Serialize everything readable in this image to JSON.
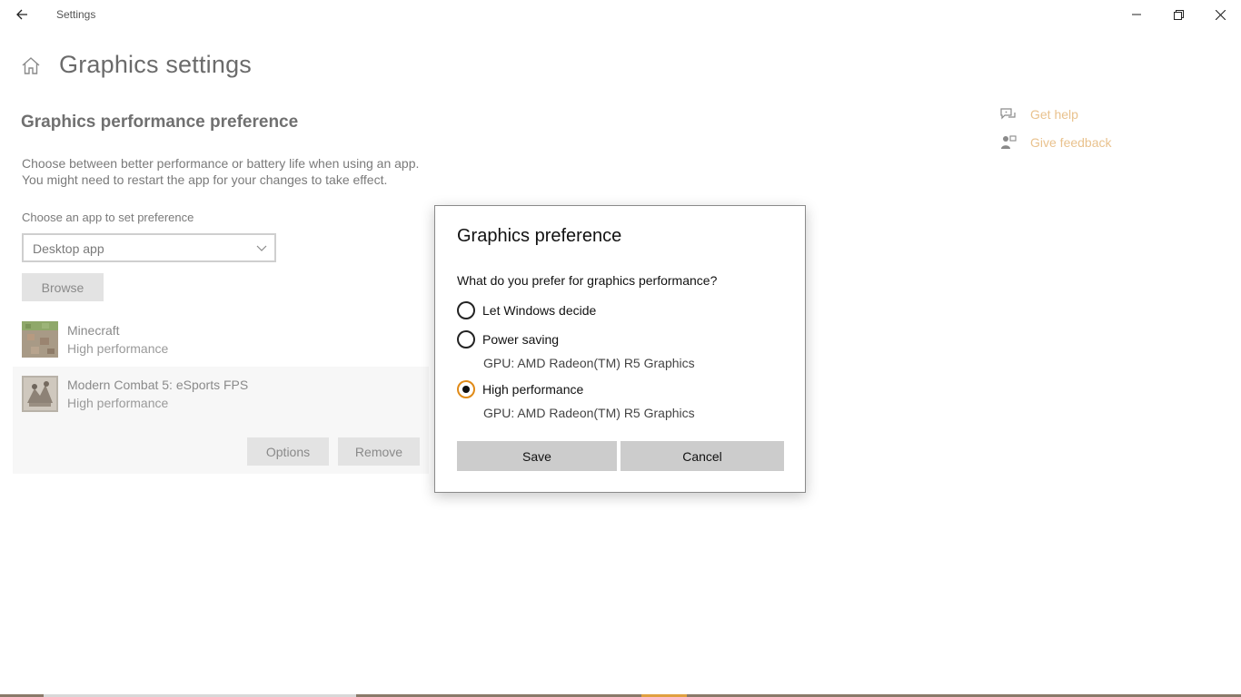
{
  "window": {
    "title": "Settings"
  },
  "page": {
    "title": "Graphics settings",
    "section_title": "Graphics performance preference",
    "description_line1": "Choose between better performance or battery life when using an app.",
    "description_line2": "You might need to restart the app for your changes to take effect.",
    "choose_label": "Choose an app to set preference",
    "dropdown_value": "Desktop app",
    "browse_label": "Browse",
    "apps": [
      {
        "name": "Minecraft",
        "preference": "High performance"
      },
      {
        "name": "Modern Combat 5: eSports FPS",
        "preference": "High performance"
      }
    ],
    "options_label": "Options",
    "remove_label": "Remove"
  },
  "help": {
    "get_help": "Get help",
    "give_feedback": "Give feedback"
  },
  "dialog": {
    "title": "Graphics preference",
    "question": "What do you prefer for graphics performance?",
    "options": [
      {
        "label": "Let Windows decide",
        "gpu": "",
        "selected": false
      },
      {
        "label": "Power saving",
        "gpu": "GPU: AMD Radeon(TM) R5 Graphics",
        "selected": false
      },
      {
        "label": "High performance",
        "gpu": "GPU: AMD Radeon(TM) R5 Graphics",
        "selected": true
      }
    ],
    "save_label": "Save",
    "cancel_label": "Cancel"
  },
  "colors": {
    "accent": "#e08a17",
    "link": "#e9c28e"
  }
}
